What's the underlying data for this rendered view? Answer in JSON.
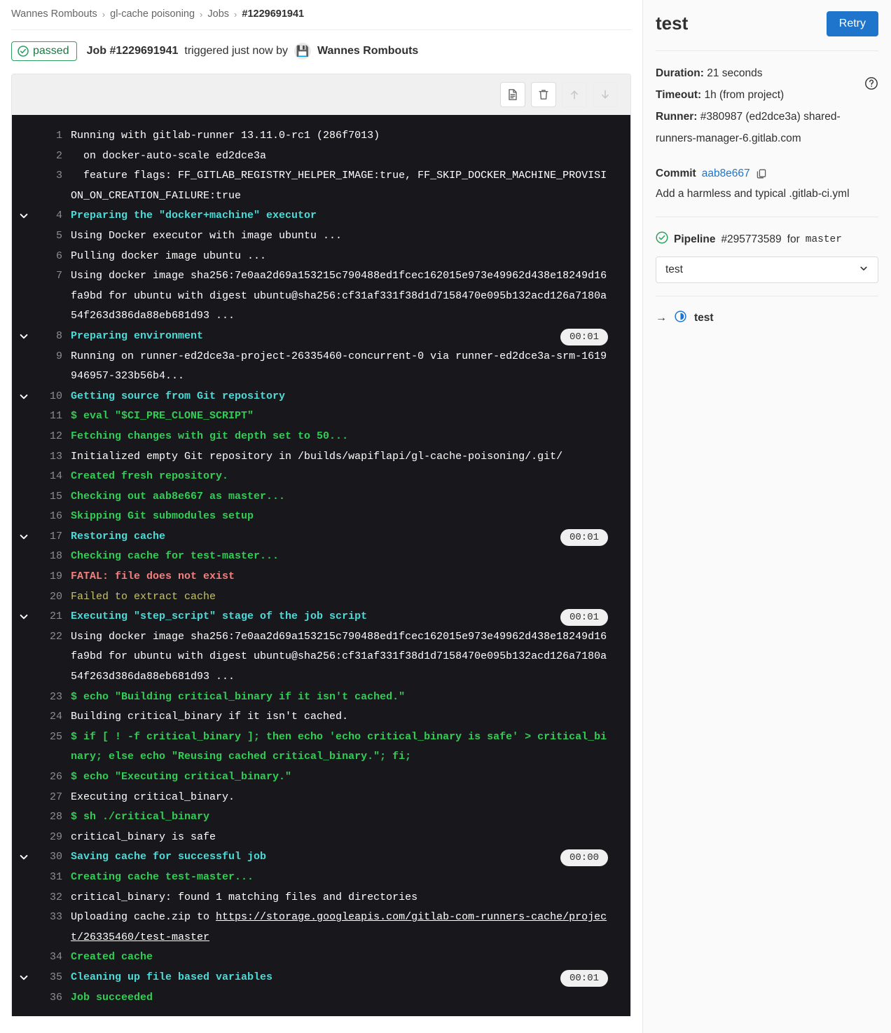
{
  "breadcrumb": {
    "items": [
      "Wannes Rombouts",
      "gl-cache poisoning",
      "Jobs"
    ],
    "current": "#1229691941",
    "separator": "›"
  },
  "job_header": {
    "status_badge": "passed",
    "job_label": "Job #1229691941",
    "trigger_text": "triggered just now by",
    "user": "Wannes Rombouts",
    "avatar_glyph": "💾"
  },
  "log_toolbar": {
    "raw_label": "Show complete raw",
    "erase_label": "Erase job log",
    "scroll_top_label": "Scroll to top",
    "scroll_bottom_label": "Scroll to bottom"
  },
  "log": {
    "lines": [
      {
        "n": "1",
        "text": "Running with gitlab-runner 13.11.0-rc1 (286f7013)",
        "color": "white",
        "chevron": false,
        "time": null
      },
      {
        "n": "2",
        "text": "  on docker-auto-scale ed2dce3a",
        "color": "white",
        "chevron": false,
        "time": null
      },
      {
        "n": "3",
        "text": "  feature flags: FF_GITLAB_REGISTRY_HELPER_IMAGE:true, FF_SKIP_DOCKER_MACHINE_PROVISION_ON_CREATION_FAILURE:true",
        "color": "white",
        "chevron": false,
        "time": null
      },
      {
        "n": "4",
        "text": "Preparing the \"docker+machine\" executor",
        "color": "cyan",
        "chevron": true,
        "time": null
      },
      {
        "n": "5",
        "text": "Using Docker executor with image ubuntu ...",
        "color": "white",
        "chevron": false,
        "time": null
      },
      {
        "n": "6",
        "text": "Pulling docker image ubuntu ...",
        "color": "white",
        "chevron": false,
        "time": null
      },
      {
        "n": "7",
        "text": "Using docker image sha256:7e0aa2d69a153215c790488ed1fcec162015e973e49962d438e18249d16fa9bd for ubuntu with digest ubuntu@sha256:cf31af331f38d1d7158470e095b132acd126a7180a54f263d386da88eb681d93 ...",
        "color": "white",
        "chevron": false,
        "time": null
      },
      {
        "n": "8",
        "text": "Preparing environment",
        "color": "cyan",
        "chevron": true,
        "time": "00:01"
      },
      {
        "n": "9",
        "text": "Running on runner-ed2dce3a-project-26335460-concurrent-0 via runner-ed2dce3a-srm-1619946957-323b56b4...",
        "color": "white",
        "chevron": false,
        "time": null
      },
      {
        "n": "10",
        "text": "Getting source from Git repository",
        "color": "cyan",
        "chevron": true,
        "time": null
      },
      {
        "n": "11",
        "text": "$ eval \"$CI_PRE_CLONE_SCRIPT\"",
        "color": "green",
        "chevron": false,
        "time": null
      },
      {
        "n": "12",
        "text": "Fetching changes with git depth set to 50...",
        "color": "green",
        "chevron": false,
        "time": null
      },
      {
        "n": "13",
        "text": "Initialized empty Git repository in /builds/wapiflapi/gl-cache-poisoning/.git/",
        "color": "white",
        "chevron": false,
        "time": null
      },
      {
        "n": "14",
        "text": "Created fresh repository.",
        "color": "green",
        "chevron": false,
        "time": null
      },
      {
        "n": "15",
        "text": "Checking out aab8e667 as master...",
        "color": "green",
        "chevron": false,
        "time": null
      },
      {
        "n": "16",
        "text": "Skipping Git submodules setup",
        "color": "green",
        "chevron": false,
        "time": null
      },
      {
        "n": "17",
        "text": "Restoring cache",
        "color": "cyan",
        "chevron": true,
        "time": "00:01"
      },
      {
        "n": "18",
        "text": "Checking cache for test-master...",
        "color": "green",
        "chevron": false,
        "time": null
      },
      {
        "n": "19",
        "text": "FATAL: file does not exist",
        "color": "red",
        "chevron": false,
        "time": null
      },
      {
        "n": "20",
        "text": "Failed to extract cache",
        "color": "yellow",
        "chevron": false,
        "time": null
      },
      {
        "n": "21",
        "text": "Executing \"step_script\" stage of the job script",
        "color": "cyan",
        "chevron": true,
        "time": "00:01"
      },
      {
        "n": "22",
        "text": "Using docker image sha256:7e0aa2d69a153215c790488ed1fcec162015e973e49962d438e18249d16fa9bd for ubuntu with digest ubuntu@sha256:cf31af331f38d1d7158470e095b132acd126a7180a54f263d386da88eb681d93 ...",
        "color": "white",
        "chevron": false,
        "time": null
      },
      {
        "n": "23",
        "text": "$ echo \"Building critical_binary if it isn't cached.\"",
        "color": "green",
        "chevron": false,
        "time": null
      },
      {
        "n": "24",
        "text": "Building critical_binary if it isn't cached.",
        "color": "white",
        "chevron": false,
        "time": null
      },
      {
        "n": "25",
        "text": "$ if [ ! -f critical_binary ]; then echo 'echo critical_binary is safe' > critical_binary; else echo \"Reusing cached critical_binary.\"; fi;",
        "color": "green",
        "chevron": false,
        "time": null
      },
      {
        "n": "26",
        "text": "$ echo \"Executing critical_binary.\"",
        "color": "green",
        "chevron": false,
        "time": null
      },
      {
        "n": "27",
        "text": "Executing critical_binary.",
        "color": "white",
        "chevron": false,
        "time": null
      },
      {
        "n": "28",
        "text": "$ sh ./critical_binary",
        "color": "green",
        "chevron": false,
        "time": null
      },
      {
        "n": "29",
        "text": "critical_binary is safe",
        "color": "white",
        "chevron": false,
        "time": null
      },
      {
        "n": "30",
        "text": "Saving cache for successful job",
        "color": "cyan",
        "chevron": true,
        "time": "00:00"
      },
      {
        "n": "31",
        "text": "Creating cache test-master...",
        "color": "green",
        "chevron": false,
        "time": null
      },
      {
        "n": "32",
        "text": "critical_binary: found 1 matching files and directories",
        "color": "white",
        "chevron": false,
        "time": null
      },
      {
        "n": "33",
        "text": "Uploading cache.zip to ",
        "link": "https://storage.googleapis.com/gitlab-com-runners-cache/project/26335460/test-master",
        "color": "white",
        "chevron": false,
        "time": null
      },
      {
        "n": "34",
        "text": "Created cache",
        "color": "green",
        "chevron": false,
        "time": null
      },
      {
        "n": "35",
        "text": "Cleaning up file based variables",
        "color": "cyan",
        "chevron": true,
        "time": "00:01"
      },
      {
        "n": "36",
        "text": "Job succeeded",
        "color": "green",
        "chevron": false,
        "time": null
      }
    ]
  },
  "sidebar": {
    "title": "test",
    "retry_label": "Retry",
    "duration_label": "Duration:",
    "duration_value": "21 seconds",
    "timeout_label": "Timeout:",
    "timeout_value": "1h (from project)",
    "runner_label": "Runner:",
    "runner_value": "#380987 (ed2dce3a) shared-runners-manager-6.gitlab.com",
    "commit_label": "Commit",
    "commit_sha": "aab8e667",
    "commit_message": "Add a harmless and typical .gitlab-ci.yml",
    "pipeline_label": "Pipeline",
    "pipeline_id": "#295773589",
    "pipeline_for": "for",
    "pipeline_ref": "master",
    "stage_selected": "test",
    "job_name": "test"
  },
  "colors": {
    "accent_blue": "#1f75cb",
    "passed_green": "#217645",
    "log_bg": "#18171b",
    "section_cyan": "#4ddbd8",
    "cmd_green": "#32cd56",
    "error_red": "#f57f7f",
    "warn_yellow": "#c6c26a"
  }
}
